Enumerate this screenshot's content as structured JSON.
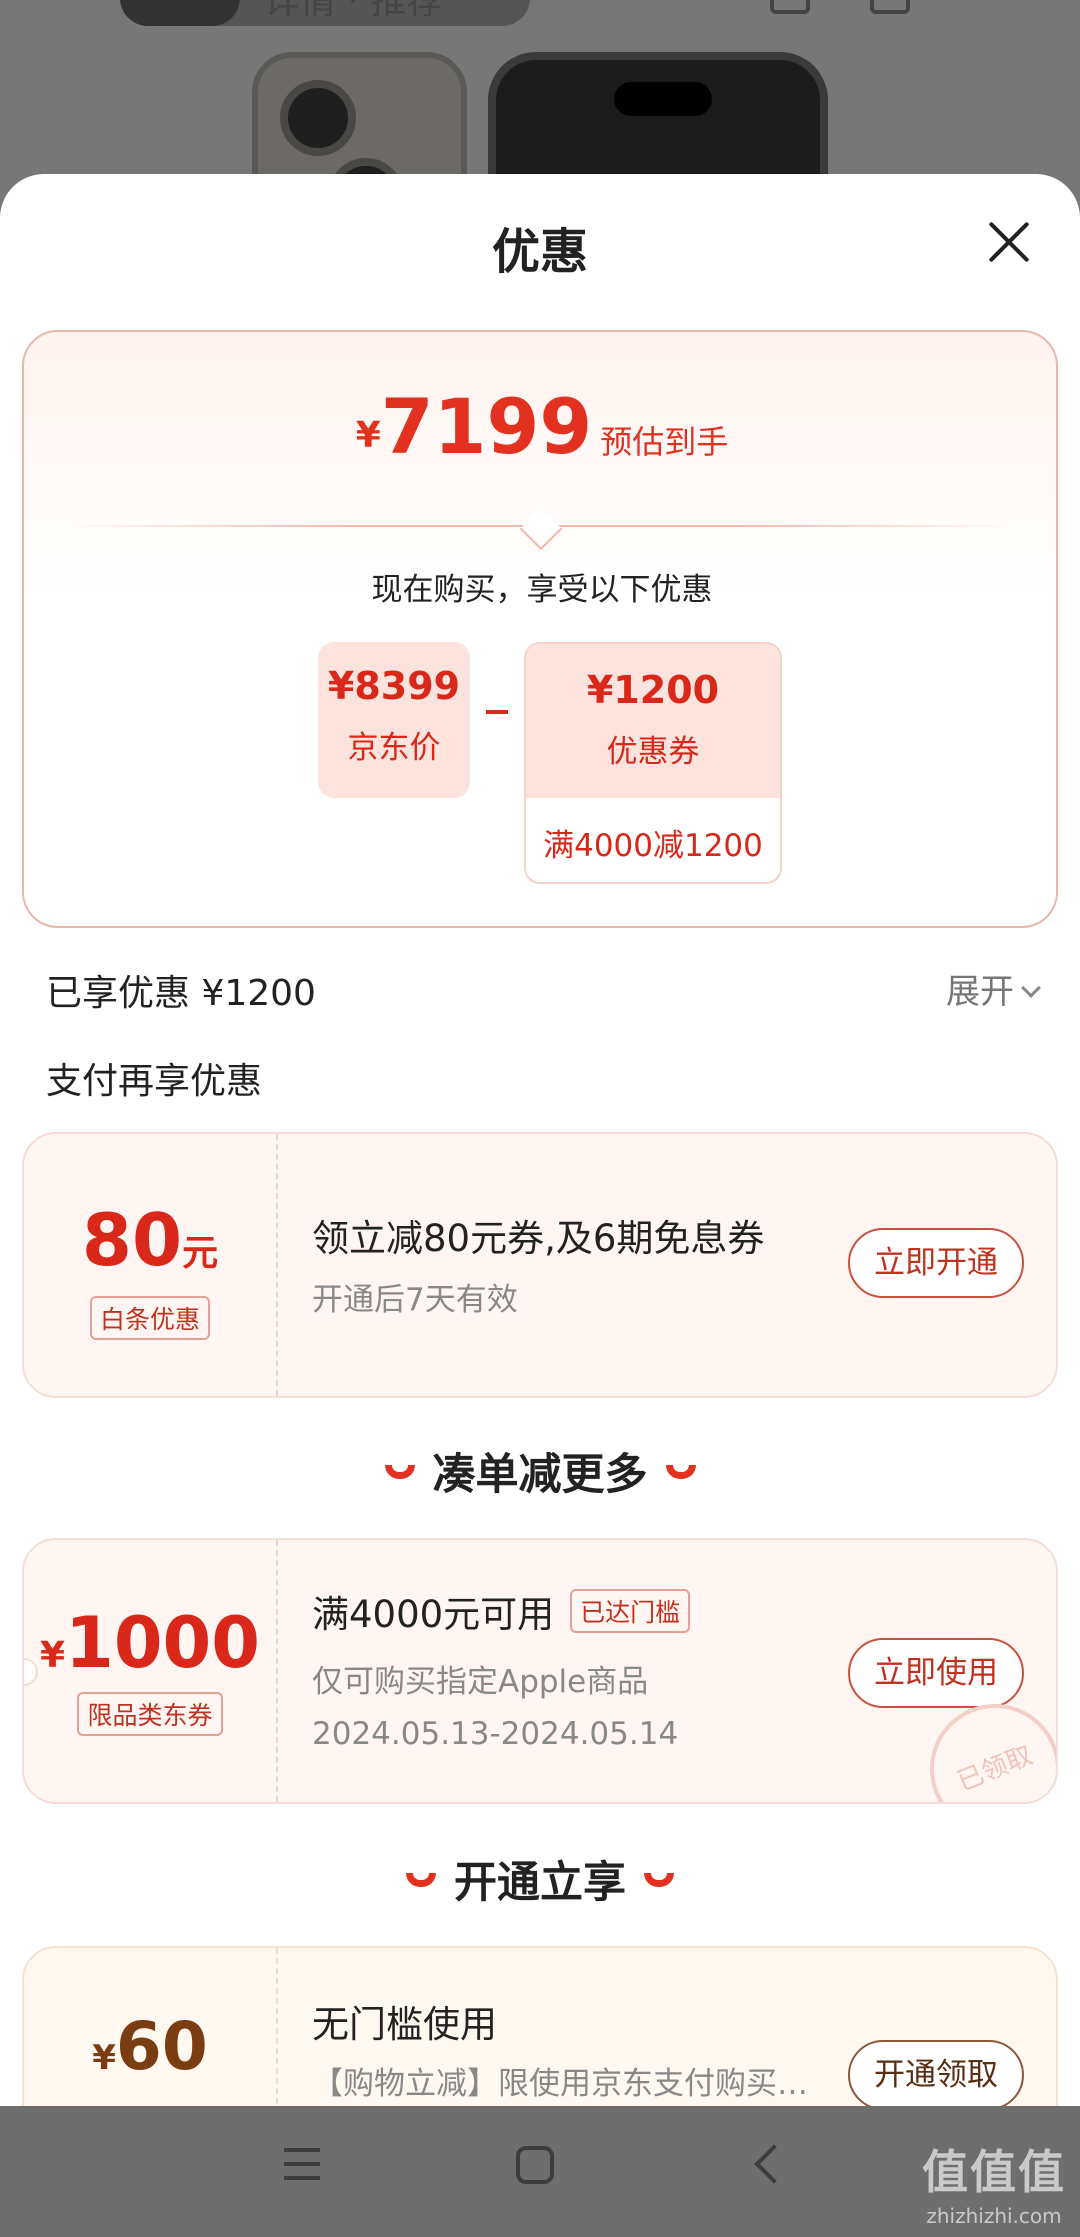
{
  "background": {
    "tab_text": "详情 · 推荐"
  },
  "sheet": {
    "title": "优惠"
  },
  "estimate": {
    "currency": "¥",
    "price": "7199",
    "label": "预估到手",
    "buy_now_text": "现在购买，享受以下优惠"
  },
  "breakdown": {
    "jd_price_value": "¥8399",
    "jd_price_label": "京东价",
    "coupon_value": "¥1200",
    "coupon_label": "优惠券",
    "coupon_condition": "满4000减1200"
  },
  "enjoyed": {
    "text": "已享优惠 ¥1200",
    "expand_label": "展开"
  },
  "pay_more_title": "支付再享优惠",
  "baitiao": {
    "amount": "80",
    "unit": "元",
    "tag": "白条优惠",
    "title": "领立减80元券,及6期免息券",
    "subtitle": "开通后7天有效",
    "action": "立即开通"
  },
  "section_more": "凑单减更多",
  "jd_coupon": {
    "currency": "¥",
    "amount": "1000",
    "tag": "限品类东券",
    "title": "满4000元可用",
    "reached": "已达门槛",
    "scope": "仅可购买指定Apple商品",
    "validity": "2024.05.13-2024.05.14",
    "action": "立即使用",
    "stamp": "已领取"
  },
  "section_open": "开通立享",
  "open_offer": {
    "currency": "¥",
    "amount": "60",
    "title": "无门槛使用",
    "subtitle": "【购物立减】限使用京东支付购买…",
    "action": "开通领取"
  },
  "watermark": {
    "big": "值值值",
    "small": "zhizhizhi.com"
  },
  "colors": {
    "accent": "#e2321f",
    "card_border": "#e8b7ac",
    "coupon_bg": "#fff6f4"
  }
}
